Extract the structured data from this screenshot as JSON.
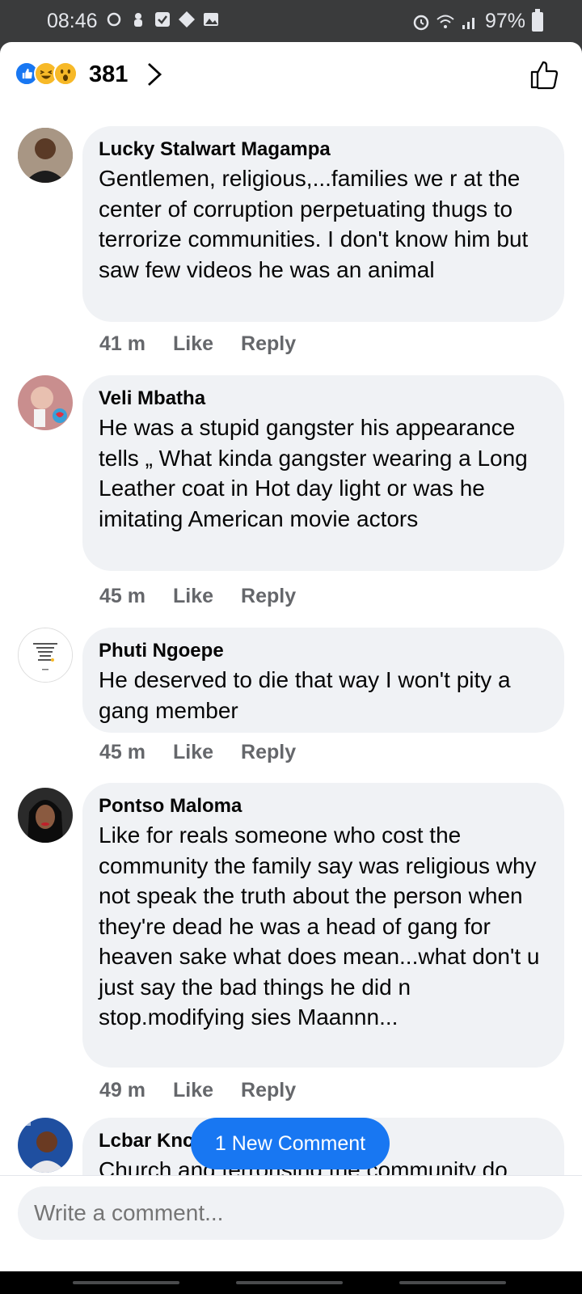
{
  "status_bar": {
    "time": "08:46",
    "battery": "97%"
  },
  "reactions": {
    "count": "381",
    "icons": [
      "like",
      "haha",
      "wow"
    ]
  },
  "comments": [
    {
      "author": "Lucky Stalwart Magampa",
      "text": "Gentlemen,  religious,...families we r at the center of corruption perpetuating thugs to terrorize communities.  I don't know him but saw few videos he was an animal",
      "time": "41 m",
      "like": "Like",
      "reply": "Reply"
    },
    {
      "author": "Veli Mbatha",
      "text": "He was a stupid gangster his appearance tells „ What kinda gangster wearing a Long Leather coat in Hot day light or was he imitating  American movie actors",
      "time": "45 m",
      "like": "Like",
      "reply": "Reply"
    },
    {
      "author": "Phuti Ngoepe",
      "text": "He deserved to die that way I won't  pity a gang member",
      "time": "45 m",
      "like": "Like",
      "reply": "Reply"
    },
    {
      "author": "Pontso Maloma",
      "text": "Like for reals someone who cost the community the family say was religious why not speak the truth about the person when they're dead he was a head of gang for heaven sake what does mean...what don't u just say the bad things he did n stop.modifying sies Maannn...",
      "time": "49 m",
      "like": "Like",
      "reply": "Reply"
    },
    {
      "author": "Lcbar Knc",
      "text": "Church and terrorising the community do"
    }
  ],
  "new_comment_button": "1 New Comment",
  "composer": {
    "placeholder": "Write a comment..."
  },
  "colors": {
    "accent": "#1877f2",
    "bubble": "#f0f2f5",
    "secondary_text": "#65676b"
  }
}
